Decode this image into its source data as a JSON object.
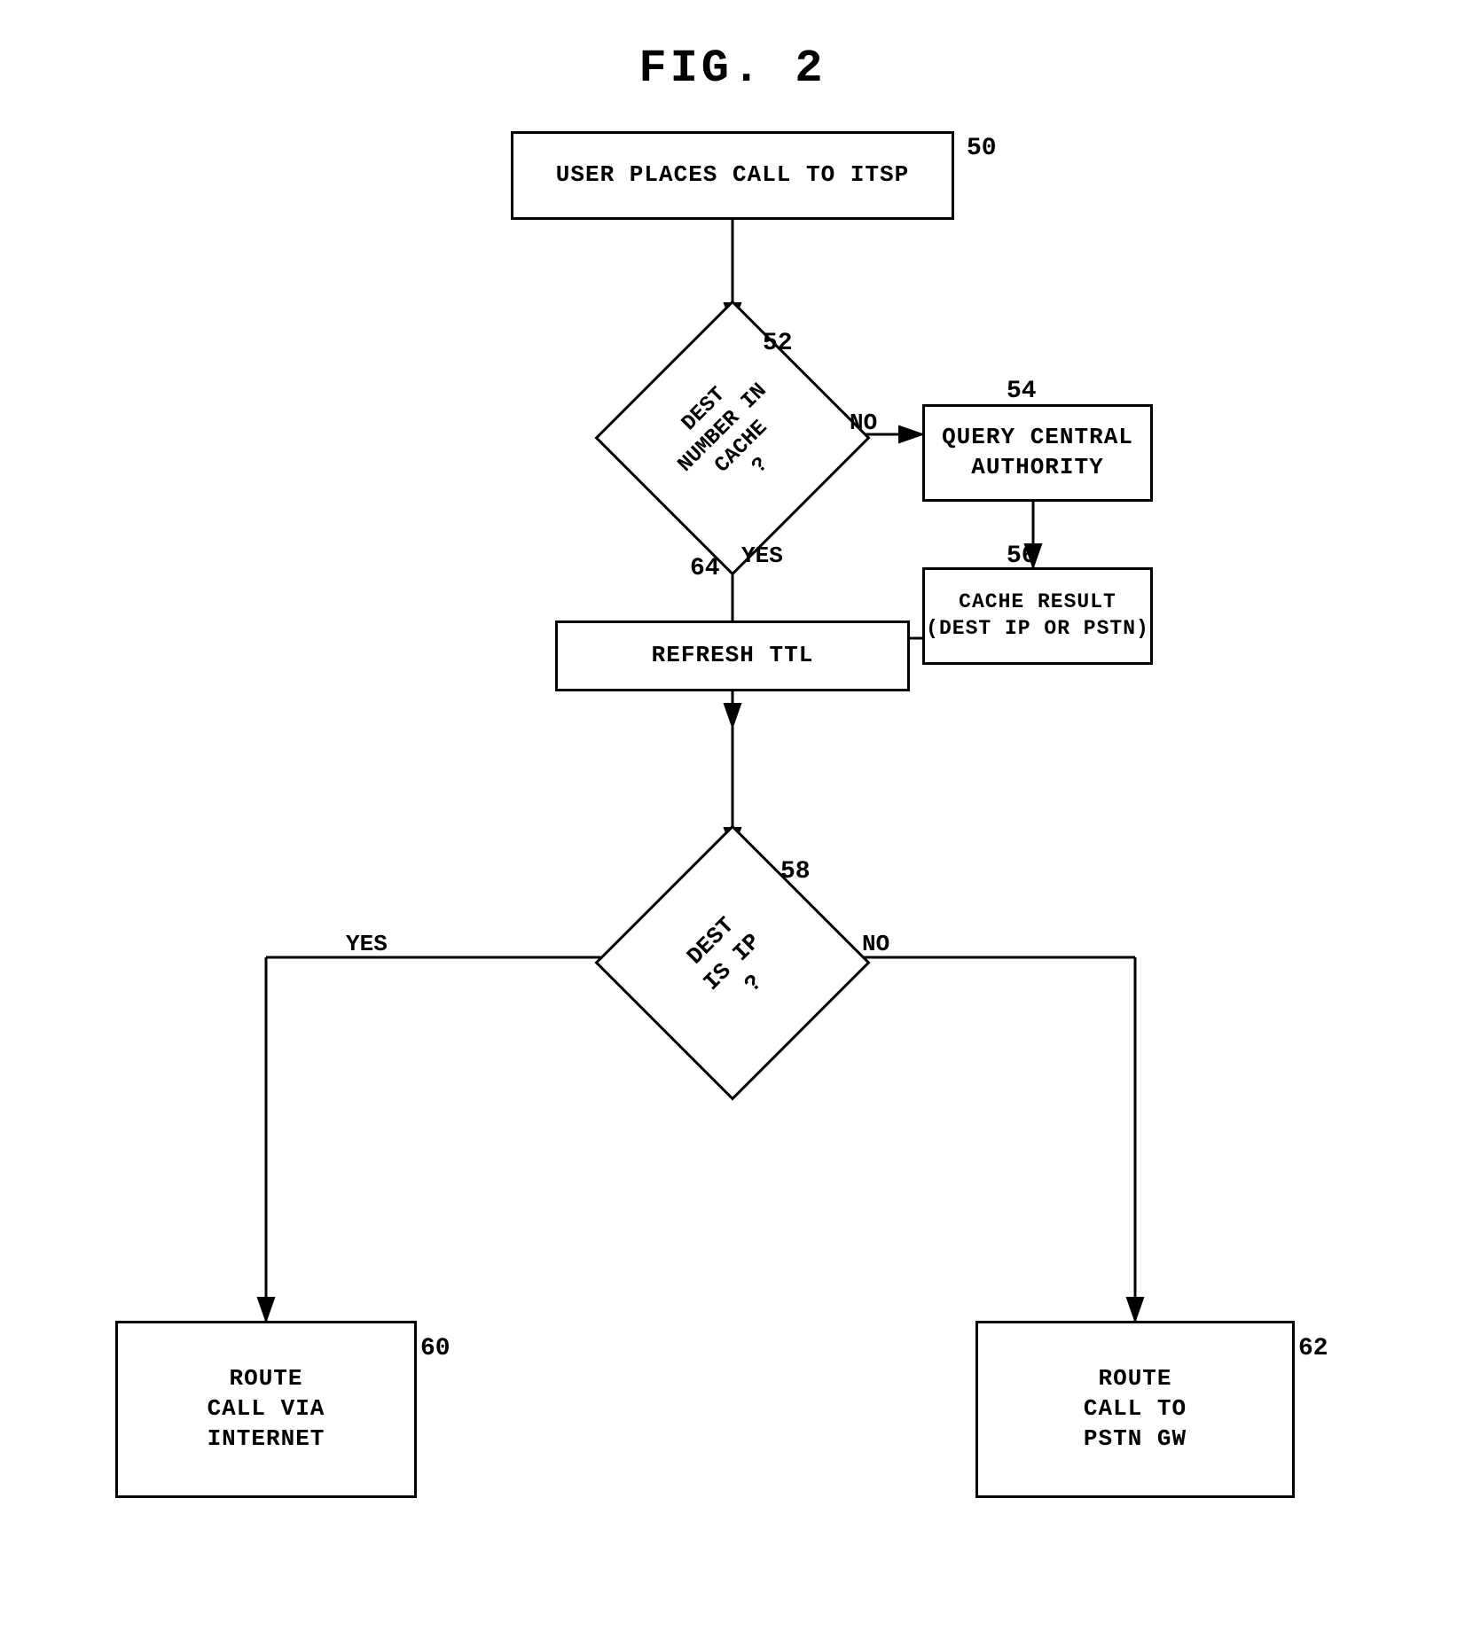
{
  "title": "FIG. 2",
  "nodes": {
    "start": {
      "label": "USER PLACES CALL TO ITSP",
      "ref": "50"
    },
    "diamond1": {
      "label": "DEST\nNUMBER IN\nCACHE\n?",
      "ref": "52"
    },
    "query_central": {
      "label": "QUERY CENTRAL\nAUTHORITY",
      "ref": "54"
    },
    "cache_result": {
      "label": "CACHE RESULT\n(DEST IP OR PSTN)",
      "ref": "56"
    },
    "refresh_ttl": {
      "label": "REFRESH TTL",
      "ref": "64"
    },
    "diamond2": {
      "label": "DEST\nIS IP\n?",
      "ref": "58"
    },
    "route_internet": {
      "label": "ROUTE\nCALL VIA\nINTERNET",
      "ref": "60"
    },
    "route_pstn": {
      "label": "ROUTE\nCALL TO\nPSTN GW",
      "ref": "62"
    }
  },
  "labels": {
    "no1": "NO",
    "yes1": "YES",
    "yes2": "YES",
    "no2": "NO"
  }
}
